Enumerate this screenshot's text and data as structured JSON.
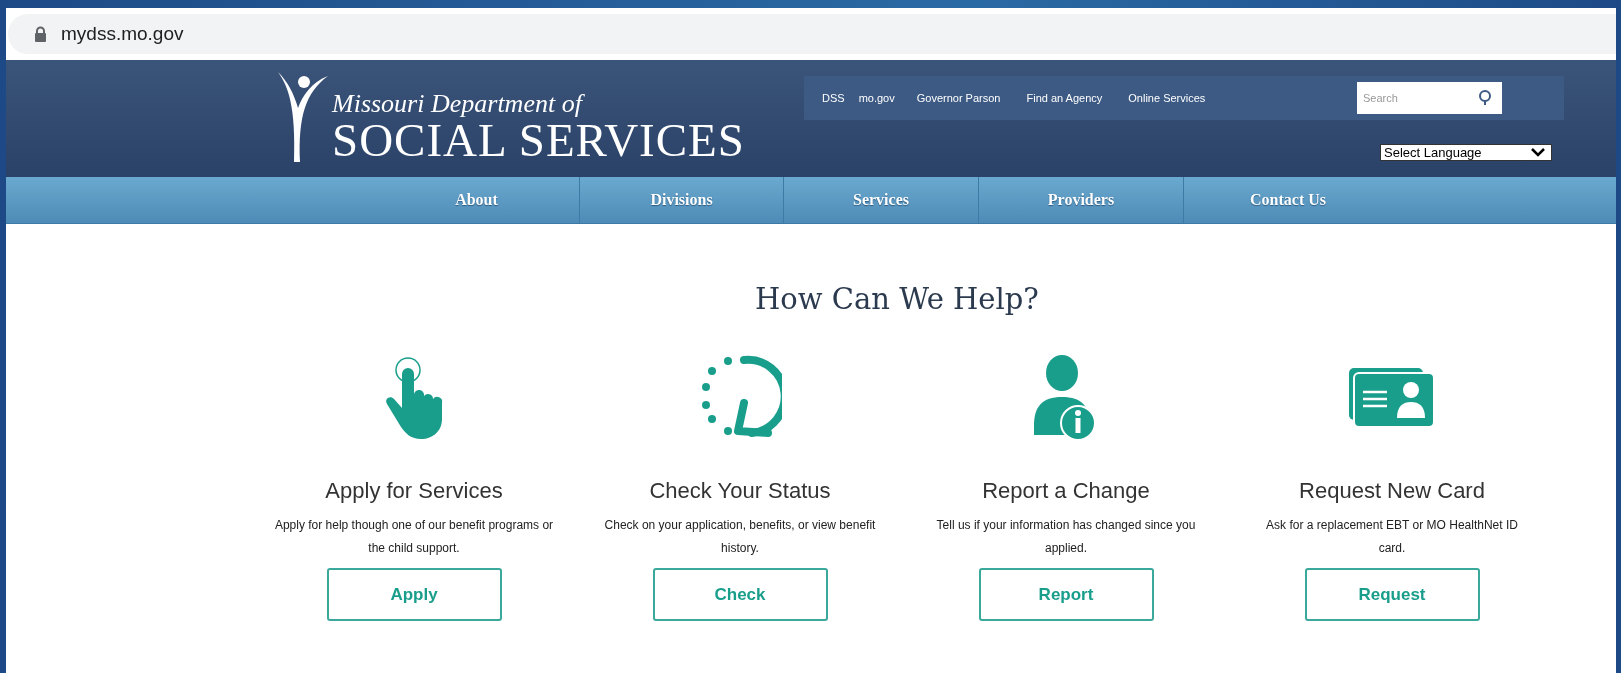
{
  "browser": {
    "url": "mydss.mo.gov"
  },
  "header": {
    "logo": {
      "line1": "Missouri Department of",
      "line2": "SOCIAL SERVICES"
    },
    "utility_links": [
      "DSS",
      "mo.gov",
      "Governor Parson",
      "Find an Agency",
      "Online Services"
    ],
    "search": {
      "placeholder": "Search"
    },
    "language_select": {
      "value": "Select Language"
    }
  },
  "nav": [
    "About",
    "Divisions",
    "Services",
    "Providers",
    "Contact Us"
  ],
  "heading": "How Can We Help?",
  "cards": [
    {
      "kind": "apply",
      "title": "Apply for Services",
      "description": "Apply for help though one of our benefit programs or the child support.",
      "button": "Apply"
    },
    {
      "kind": "check",
      "title": "Check Your Status",
      "description": "Check on your application, benefits, or view benefit history.",
      "button": "Check"
    },
    {
      "kind": "report",
      "title": "Report a Change",
      "description": "Tell us if your information has changed since you applied.",
      "button": "Report"
    },
    {
      "kind": "request",
      "title": "Request New Card",
      "description": "Ask for a replacement EBT or MO HealthNet ID card.",
      "button": "Request"
    }
  ]
}
